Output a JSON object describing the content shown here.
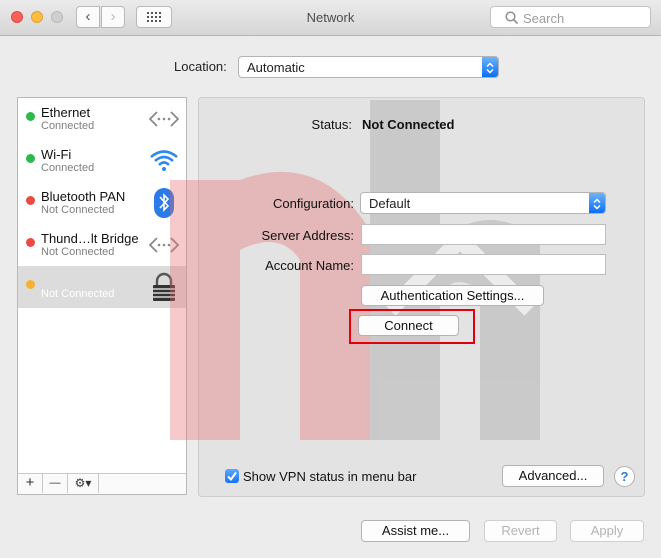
{
  "window": {
    "title": "Network"
  },
  "toolbar": {
    "back": "‹",
    "forward": "›",
    "search_placeholder": "Search"
  },
  "location": {
    "label": "Location:",
    "value": "Automatic"
  },
  "services": [
    {
      "name": "Ethernet",
      "status": "Connected",
      "dot": "#2fb94b",
      "icon": "ethernet-icon"
    },
    {
      "name": "Wi-Fi",
      "status": "Connected",
      "dot": "#2fb94b",
      "icon": "wifi-icon"
    },
    {
      "name": "Bluetooth PAN",
      "status": "Not Connected",
      "dot": "#ec4b43",
      "icon": "bluetooth-icon"
    },
    {
      "name": "Thund…lt Bridge",
      "status": "Not Connected",
      "dot": "#ec4b43",
      "icon": "thunderbolt-bridge-icon"
    },
    {
      "name": "",
      "status": "Not Connected",
      "dot": "#f5b131",
      "icon": "vpn-lock-icon",
      "selected": true
    }
  ],
  "sidebar_footer": {
    "add": "+",
    "remove": "—",
    "gear": "⚙▾"
  },
  "detail": {
    "status_label": "Status:",
    "status_value": "Not Connected",
    "configuration_label": "Configuration:",
    "configuration_value": "Default",
    "server_label": "Server Address:",
    "server_value": "",
    "account_label": "Account Name:",
    "account_value": "",
    "auth_button": "Authentication Settings...",
    "connect_button": "Connect",
    "show_vpn_label": "Show VPN status in menu bar",
    "show_vpn_checked": true,
    "advanced_button": "Advanced...",
    "help": "?"
  },
  "bottom": {
    "assist": "Assist me...",
    "revert": "Revert",
    "apply": "Apply"
  },
  "colors": {
    "accent": "#1a72f0",
    "highlight": "#e0000f"
  }
}
